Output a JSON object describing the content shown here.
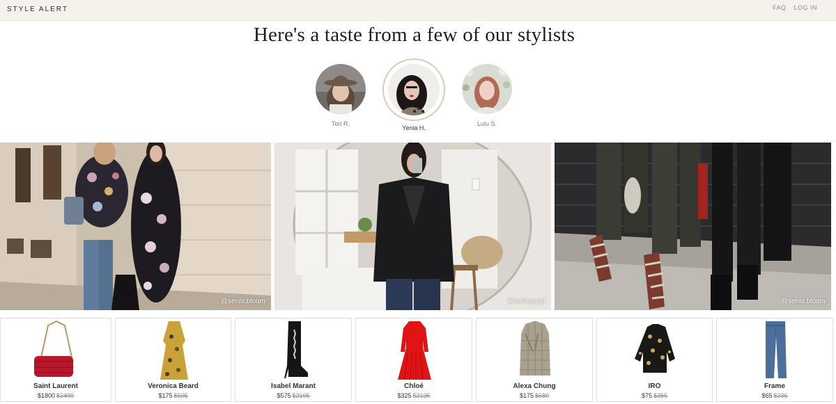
{
  "header": {
    "logo": "STYLE ALERT",
    "nav": {
      "faq": "FAQ",
      "login": "LOG IN"
    }
  },
  "headline": "Here's a taste from a few of our stylists",
  "stylists": [
    {
      "name": "Tori R."
    },
    {
      "name": "Yenia H.",
      "active": true
    },
    {
      "name": "Lulu S."
    }
  ],
  "photos": [
    {
      "credit": "@senni.bloom"
    },
    {
      "credit": "@imokaygirl"
    },
    {
      "credit": "@senni.bloom"
    }
  ],
  "products": [
    {
      "brand": "Saint Laurent",
      "price": "$1800",
      "original_price": "$2490",
      "icon": "red-croc-shoulder-bag"
    },
    {
      "brand": "Veronica Beard",
      "price": "$175",
      "original_price": "$595",
      "icon": "floral-print-dress"
    },
    {
      "brand": "Isabel Marant",
      "price": "$575",
      "original_price": "$2195",
      "icon": "black-embellished-boot"
    },
    {
      "brand": "Chloé",
      "price": "$325",
      "original_price": "$2135",
      "icon": "red-pleated-dress"
    },
    {
      "brand": "Alexa Chung",
      "price": "$175",
      "original_price": "$680",
      "icon": "check-blazer"
    },
    {
      "brand": "IRO",
      "price": "$75",
      "original_price": "$355",
      "icon": "black-gold-print-blouse"
    },
    {
      "brand": "Frame",
      "price": "$65",
      "original_price": "$236",
      "icon": "blue-jeans"
    }
  ]
}
